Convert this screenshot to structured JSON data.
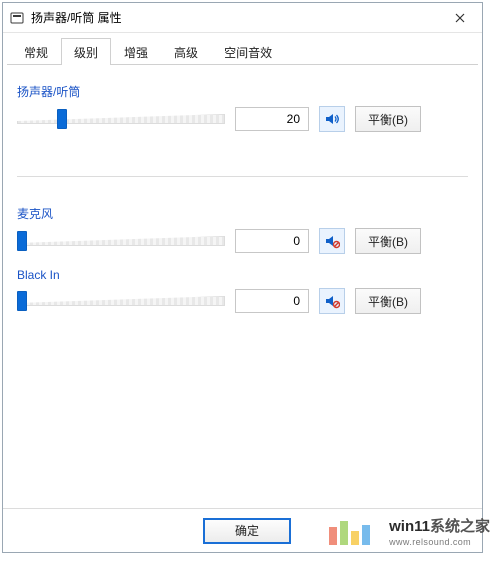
{
  "window": {
    "title": "扬声器/听筒 属性"
  },
  "tabs": [
    {
      "label": "常规"
    },
    {
      "label": "级别"
    },
    {
      "label": "增强"
    },
    {
      "label": "高级"
    },
    {
      "label": "空间音效"
    }
  ],
  "active_tab_index": 1,
  "output": {
    "label": "扬声器/听筒",
    "value": "20",
    "slider": 20,
    "balance_label": "平衡(B)",
    "muted": false
  },
  "inputs": [
    {
      "label": "麦克风",
      "value": "0",
      "slider": 0,
      "balance_label": "平衡(B)",
      "muted": true
    },
    {
      "label": "Black In",
      "value": "0",
      "slider": 0,
      "balance_label": "平衡(B)",
      "muted": true
    }
  ],
  "buttons": {
    "ok": "确定"
  },
  "watermark": {
    "line1_a": "win11",
    "line1_b": "系统之家",
    "line2": "www.relsound.com",
    "colors": [
      "#e74424",
      "#7bbf28",
      "#f5b400",
      "#1e8fe0"
    ]
  }
}
